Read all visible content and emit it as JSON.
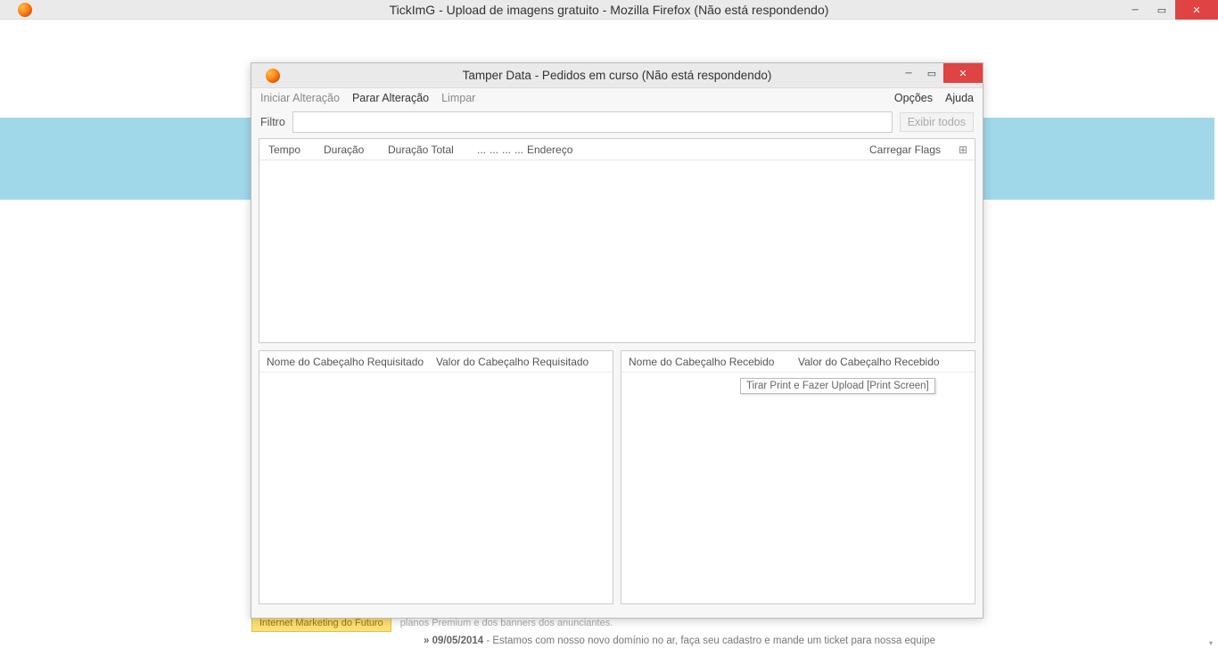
{
  "main_window": {
    "title": "TickImG - Upload de imagens gratuito - Mozilla Firefox (Não está respondendo)"
  },
  "dialog": {
    "title": "Tamper Data - Pedidos em curso (Não está respondendo)",
    "menu": {
      "iniciar": "Iniciar Alteração",
      "parar": "Parar Alteração",
      "limpar": "Limpar",
      "opcoes": "Opções",
      "ajuda": "Ajuda"
    },
    "filter": {
      "label": "Filtro",
      "show_all": "Exibir todos",
      "value": ""
    },
    "columns": {
      "tempo": "Tempo",
      "duracao": "Duração",
      "duracao_total": "Duração Total",
      "dots": "...",
      "endereco": "Endereço",
      "flags": "Carregar Flags",
      "picker": "⊞"
    },
    "left_panel": {
      "col1": "Nome do Cabeçalho Requisitado",
      "col2": "Valor do Cabeçalho Requisitado"
    },
    "right_panel": {
      "col1": "Nome do Cabeçalho Recebido",
      "col2": "Valor do Cabeçalho Recebido"
    }
  },
  "tooltip": {
    "text": "Tirar Print e Fazer Upload [Print Screen]"
  },
  "bottom": {
    "yellow": "Internet Marketing do Futuro",
    "gray": "planos Premium e dos banners dos anunciantes.",
    "date": "» 09/05/2014",
    "news": " - Estamos com nosso novo domínio no ar, faça seu cadastro e mande um ticket para nossa equipe"
  }
}
